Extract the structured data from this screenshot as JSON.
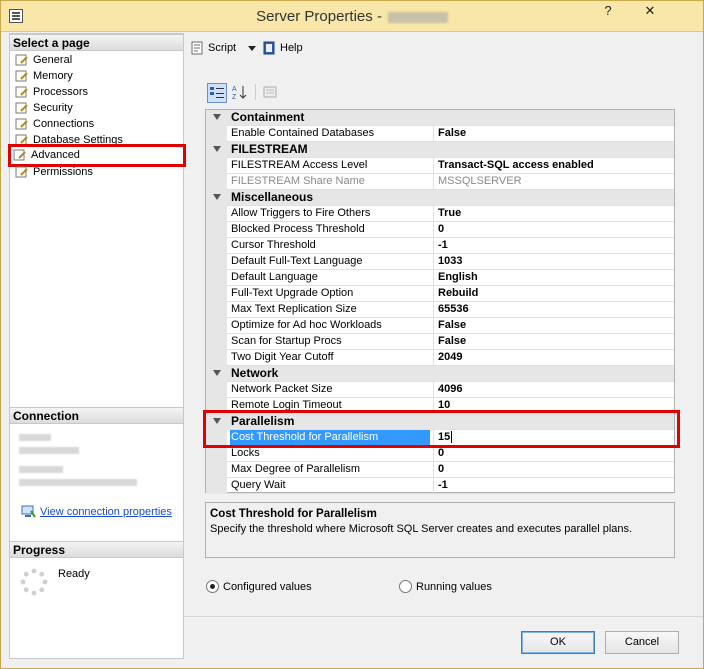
{
  "window": {
    "title": "Server Properties -",
    "help_glyph": "?",
    "close_glyph": "✕"
  },
  "left": {
    "select_header": "Select a page",
    "pages": [
      "General",
      "Memory",
      "Processors",
      "Security",
      "Connections",
      "Database Settings",
      "Advanced",
      "Permissions"
    ],
    "selected_page": "Advanced",
    "connection_header": "Connection",
    "view_connection_link": "View connection properties",
    "progress_header": "Progress",
    "progress_status": "Ready"
  },
  "toolbar": {
    "script_label": "Script",
    "help_label": "Help"
  },
  "grid": {
    "categories": {
      "containment": "Containment",
      "filestream": "FILESTREAM",
      "misc": "Miscellaneous",
      "network": "Network",
      "parallelism": "Parallelism"
    },
    "rows": {
      "enable_contained": {
        "name": "Enable Contained Databases",
        "value": "False"
      },
      "fs_access": {
        "name": "FILESTREAM Access Level",
        "value": "Transact-SQL access enabled"
      },
      "fs_share": {
        "name": "FILESTREAM Share Name",
        "value": "MSSQLSERVER"
      },
      "allow_triggers": {
        "name": "Allow Triggers to Fire Others",
        "value": "True"
      },
      "blocked_threshold": {
        "name": "Blocked Process Threshold",
        "value": "0"
      },
      "cursor_threshold": {
        "name": "Cursor Threshold",
        "value": "-1"
      },
      "default_fulltext_lang": {
        "name": "Default Full-Text Language",
        "value": "1033"
      },
      "default_lang": {
        "name": "Default Language",
        "value": "English"
      },
      "fulltext_upgrade": {
        "name": "Full-Text Upgrade Option",
        "value": "Rebuild"
      },
      "max_text_repl": {
        "name": "Max Text Replication Size",
        "value": "65536"
      },
      "optimize_adhoc": {
        "name": "Optimize for Ad hoc Workloads",
        "value": "False"
      },
      "scan_startup": {
        "name": "Scan for Startup Procs",
        "value": "False"
      },
      "two_digit": {
        "name": "Two Digit Year Cutoff",
        "value": "2049"
      },
      "packet_size": {
        "name": "Network Packet Size",
        "value": "4096"
      },
      "remote_timeout": {
        "name": "Remote Login Timeout",
        "value": "10"
      },
      "cost_threshold": {
        "name": "Cost Threshold for Parallelism",
        "value": "15"
      },
      "locks": {
        "name": "Locks",
        "value": "0"
      },
      "maxdop": {
        "name": "Max Degree of Parallelism",
        "value": "0"
      },
      "query_wait": {
        "name": "Query Wait",
        "value": "-1"
      }
    }
  },
  "description": {
    "title": "Cost Threshold for Parallelism",
    "body": "Specify the threshold where Microsoft SQL Server creates and executes parallel plans."
  },
  "options": {
    "configured": "Configured values",
    "running": "Running values",
    "selected": "configured"
  },
  "buttons": {
    "ok": "OK",
    "cancel": "Cancel"
  }
}
